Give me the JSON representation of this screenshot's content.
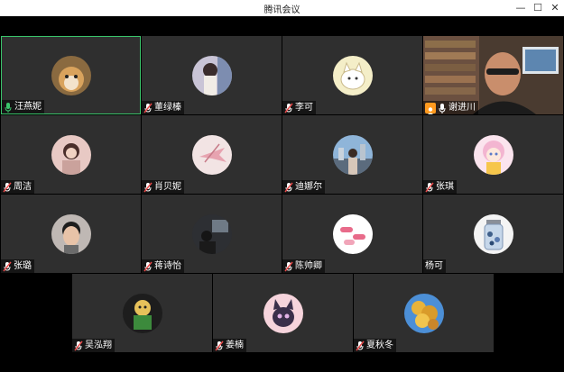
{
  "window": {
    "title": "腾讯会议"
  },
  "colors": {
    "tile_bg": "#2f2f2f",
    "active_border": "#3bc46b",
    "mic_muted": "#e94b4b",
    "mic_on": "#3bc46b",
    "host_badge": "#ff9a1f"
  },
  "participants": [
    {
      "name": "汪燕妮",
      "avatar": "shiba-dog-photo",
      "mic": "on",
      "active": true
    },
    {
      "name": "董绿榛",
      "avatar": "girl-photo",
      "mic": "muted"
    },
    {
      "name": "李可",
      "avatar": "cartoon-cat-illustration",
      "mic": "muted"
    },
    {
      "name": "谢进川",
      "avatar": "camera-video",
      "mic": "on",
      "host": true
    },
    {
      "name": "周洁",
      "avatar": "girl-portrait",
      "mic": "muted"
    },
    {
      "name": "肖贝妮",
      "avatar": "airplane-sketch",
      "mic": "muted"
    },
    {
      "name": "迪娜尔",
      "avatar": "city-photo",
      "mic": "muted"
    },
    {
      "name": "张琪",
      "avatar": "anime-girl",
      "mic": "muted"
    },
    {
      "name": "张璐",
      "avatar": "man-photo",
      "mic": "muted"
    },
    {
      "name": "蒋诗怡",
      "avatar": "dark-room-photo",
      "mic": "muted"
    },
    {
      "name": "陈帅卿",
      "avatar": "pills-illustration",
      "mic": "muted"
    },
    {
      "name": "杨可",
      "avatar": "jar-illustration",
      "mic": "none"
    },
    {
      "name": "吴泓翔",
      "avatar": "cartoon-character",
      "mic": "muted"
    },
    {
      "name": "姜楠",
      "avatar": "black-cat-illustration",
      "mic": "muted"
    },
    {
      "name": "夏秋冬",
      "avatar": "yellow-flowers-photo",
      "mic": "muted"
    }
  ]
}
